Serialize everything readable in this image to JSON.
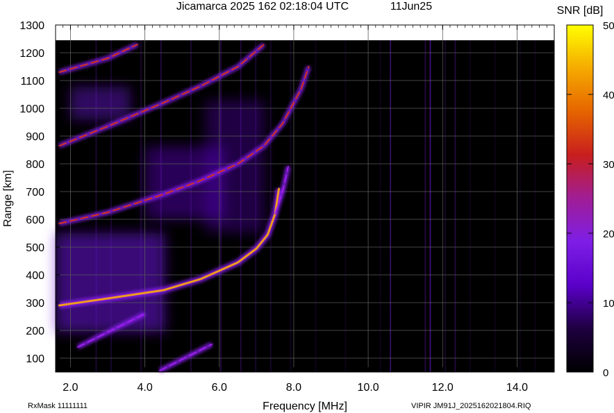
{
  "header": {
    "title": "Jicamarca 2025 162 02:18:04 UTC",
    "date": "11Jun25"
  },
  "footer": {
    "rxmask": "RxMask 11111111",
    "file": "VIPIR  JM91J_2025162021804.RIQ"
  },
  "colorbar": {
    "label": "SNR [dB]",
    "ticks": [
      "50",
      "40",
      "30",
      "20",
      "10",
      "0"
    ],
    "stops": [
      "#000000",
      "#1e0040",
      "#5a00c8",
      "#7d1ee6",
      "#a01e96",
      "#c81e1e",
      "#e66400",
      "#f5aa00",
      "#ffff00"
    ]
  },
  "chart_data": {
    "type": "heatmap",
    "title": "Jicamarca 2025 162 02:18:04 UTC",
    "xlabel": "Frequency [MHz]",
    "ylabel": "Range [km]",
    "xlim": [
      1.6,
      15.0
    ],
    "ylim": [
      50,
      1300
    ],
    "xticks": [
      "2.0",
      "4.0",
      "6.0",
      "8.0",
      "10.0",
      "12.0",
      "14.0"
    ],
    "yticks": [
      "100",
      "200",
      "300",
      "400",
      "500",
      "600",
      "700",
      "800",
      "900",
      "1000",
      "1100",
      "1200",
      "1300"
    ],
    "zlabel": "SNR [dB]",
    "zlim": [
      0,
      50
    ],
    "grid": true,
    "traces": [
      {
        "name": "",
        "f": [
          1.7,
          3.0,
          4.5,
          5.5,
          6.5,
          7.0,
          7.3,
          7.5,
          7.6
        ],
        "range": [
          290,
          315,
          345,
          385,
          445,
          495,
          545,
          620,
          710
        ]
      },
      {
        "name": "",
        "f": [
          1.7,
          3.0,
          4.5,
          5.5,
          6.5,
          7.2,
          7.7,
          8.2,
          8.4
        ],
        "range": [
          585,
          625,
          690,
          740,
          800,
          865,
          945,
          1070,
          1150
        ]
      },
      {
        "name": "",
        "f": [
          1.7,
          3.0,
          4.5,
          5.5,
          6.5,
          7.2
        ],
        "range": [
          865,
          935,
          1020,
          1080,
          1150,
          1230
        ]
      },
      {
        "name": "",
        "f": [
          1.7,
          3.0,
          3.8
        ],
        "range": [
          1130,
          1180,
          1230
        ]
      },
      {
        "name": "",
        "f": [
          7.5,
          7.7,
          7.85
        ],
        "range": [
          620,
          700,
          790
        ]
      },
      {
        "name": "",
        "f": [
          4.4,
          5.8
        ],
        "range": [
          55,
          150
        ]
      },
      {
        "name": "",
        "f": [
          2.2,
          4.0
        ],
        "range": [
          140,
          260
        ]
      }
    ]
  }
}
